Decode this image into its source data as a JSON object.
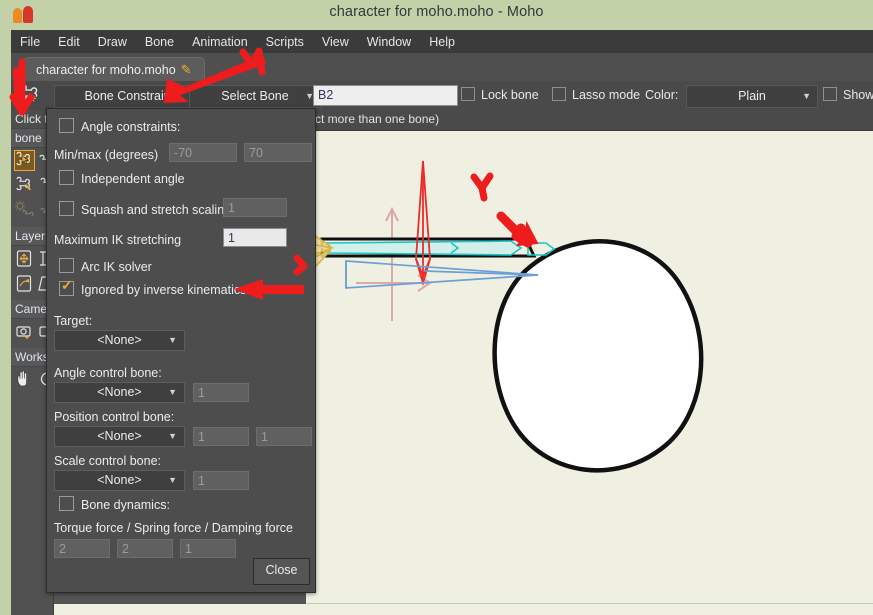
{
  "window": {
    "title": "character for moho.moho - Moho",
    "logo_icon": "moho-logo-icon"
  },
  "menubar": {
    "items": [
      {
        "label": "File"
      },
      {
        "label": "Edit"
      },
      {
        "label": "Draw"
      },
      {
        "label": "Bone"
      },
      {
        "label": "Animation"
      },
      {
        "label": "Scripts"
      },
      {
        "label": "View"
      },
      {
        "label": "Window"
      },
      {
        "label": "Help"
      }
    ]
  },
  "tabstrip": {
    "document_tab": "character for moho.moho",
    "modified_icon": "pencil-icon"
  },
  "toolbar": {
    "tool_icon": "bone-select-tool-icon",
    "tool_combo": "Bone Constraints",
    "mode_combo": "Select Bone",
    "bone_name_value": "B2",
    "lock_bone_label": "Lock bone",
    "lock_bone_checked": false,
    "lasso_mode_label": "Lasso mode",
    "lasso_mode_checked": false,
    "color_label": "Color:",
    "color_combo": "Plain",
    "show_labels_label": "Show lab",
    "show_labels_checked": false,
    "dropdown_arrow": "▼"
  },
  "hintbar": {
    "text": "ct more than one bone)"
  },
  "sidebar": {
    "hint_label": "Click t",
    "groups": [
      {
        "title": "bone",
        "icons": [
          {
            "name": "select-bone-icon",
            "selected": true
          },
          {
            "name": "add-bone-icon",
            "selected": false
          },
          {
            "name": "manipulate-bone-icon",
            "selected": false
          },
          {
            "name": "bone-strength-icon",
            "selected": false
          },
          {
            "name": "offset-bone-icon",
            "selected": false
          },
          {
            "name": "bind-points-icon",
            "selected": false
          }
        ]
      },
      {
        "title": "Layer",
        "icons": [
          {
            "name": "translate-layer-icon",
            "selected": false
          },
          {
            "name": "scale-layer-icon",
            "selected": false
          },
          {
            "name": "rotate-layer-icon",
            "selected": false
          },
          {
            "name": "shear-layer-icon",
            "selected": false
          }
        ]
      },
      {
        "title": "Camer",
        "icons": [
          {
            "name": "track-camera-icon",
            "selected": false
          },
          {
            "name": "zoom-camera-icon",
            "selected": false
          }
        ]
      },
      {
        "title": "Works",
        "icons": [
          {
            "name": "pan-workspace-icon",
            "selected": false
          },
          {
            "name": "orbit-workspace-icon",
            "selected": false
          }
        ]
      }
    ]
  },
  "dialog": {
    "angle_constraints_label": "Angle constraints:",
    "angle_constraints_checked": false,
    "minmax_label": "Min/max (degrees)",
    "min_value": "-70",
    "max_value": "70",
    "independent_angle_label": "Independent angle",
    "independent_angle_checked": false,
    "squash_stretch_label": "Squash and stretch scaling",
    "squash_stretch_checked": false,
    "squash_stretch_value": "1",
    "max_ik_label": "Maximum IK stretching",
    "max_ik_value": "1",
    "arc_ik_label": "Arc IK solver",
    "arc_ik_checked": false,
    "ignored_ik_label": "Ignored by inverse kinematics",
    "ignored_ik_checked": true,
    "target_label": "Target:",
    "target_value": "<None>",
    "angle_control_label": "Angle control bone:",
    "angle_control_value": "<None>",
    "angle_control_scalar": "1",
    "position_control_label": "Position control bone:",
    "position_control_value": "<None>",
    "position_control_scalar_x": "1",
    "position_control_scalar_y": "1",
    "scale_control_label": "Scale control bone:",
    "scale_control_value": "<None>",
    "scale_control_scalar": "1",
    "bone_dynamics_label": "Bone dynamics:",
    "bone_dynamics_checked": false,
    "forces_label": "Torque force / Spring force / Damping force",
    "torque_value": "2",
    "spring_value": "2",
    "damping_value": "1",
    "close_label": "Close",
    "dropdown_arrow": "▼"
  },
  "canvas": {
    "background_color": "#f0f0e2",
    "shapes": [
      {
        "name": "head-circle",
        "stroke": "#000000"
      },
      {
        "name": "arm-outline",
        "stroke": "#000000"
      },
      {
        "name": "origin-crosshair",
        "stroke": "#d9a3a3"
      }
    ],
    "bones": [
      {
        "name": "bone-b2-selected",
        "color": "#28c8c8"
      },
      {
        "name": "bone-head-vertical",
        "color": "#ec2d2d"
      },
      {
        "name": "bone-head-horizontal",
        "color": "#6c9fd8"
      },
      {
        "name": "bone-hand-cluster",
        "color": "#e8c96a"
      }
    ]
  },
  "annotations": [
    {
      "name": "arrow-to-tool-combo",
      "color": "#ee1c1c"
    },
    {
      "name": "mark-near-scripts-menu",
      "color": "#ee1c1c"
    },
    {
      "name": "arrow-to-sidebar-bone-tool",
      "color": "#ee1c1c"
    },
    {
      "name": "arrow-to-ignored-ik-checkbox",
      "color": "#ee1c1c"
    },
    {
      "name": "mark-above-ignored-ik-arrow",
      "color": "#ee1c1c"
    },
    {
      "name": "arrow-to-head-bone",
      "color": "#ee1c1c"
    },
    {
      "name": "mark-above-head-arrow",
      "color": "#ee1c1c"
    }
  ]
}
